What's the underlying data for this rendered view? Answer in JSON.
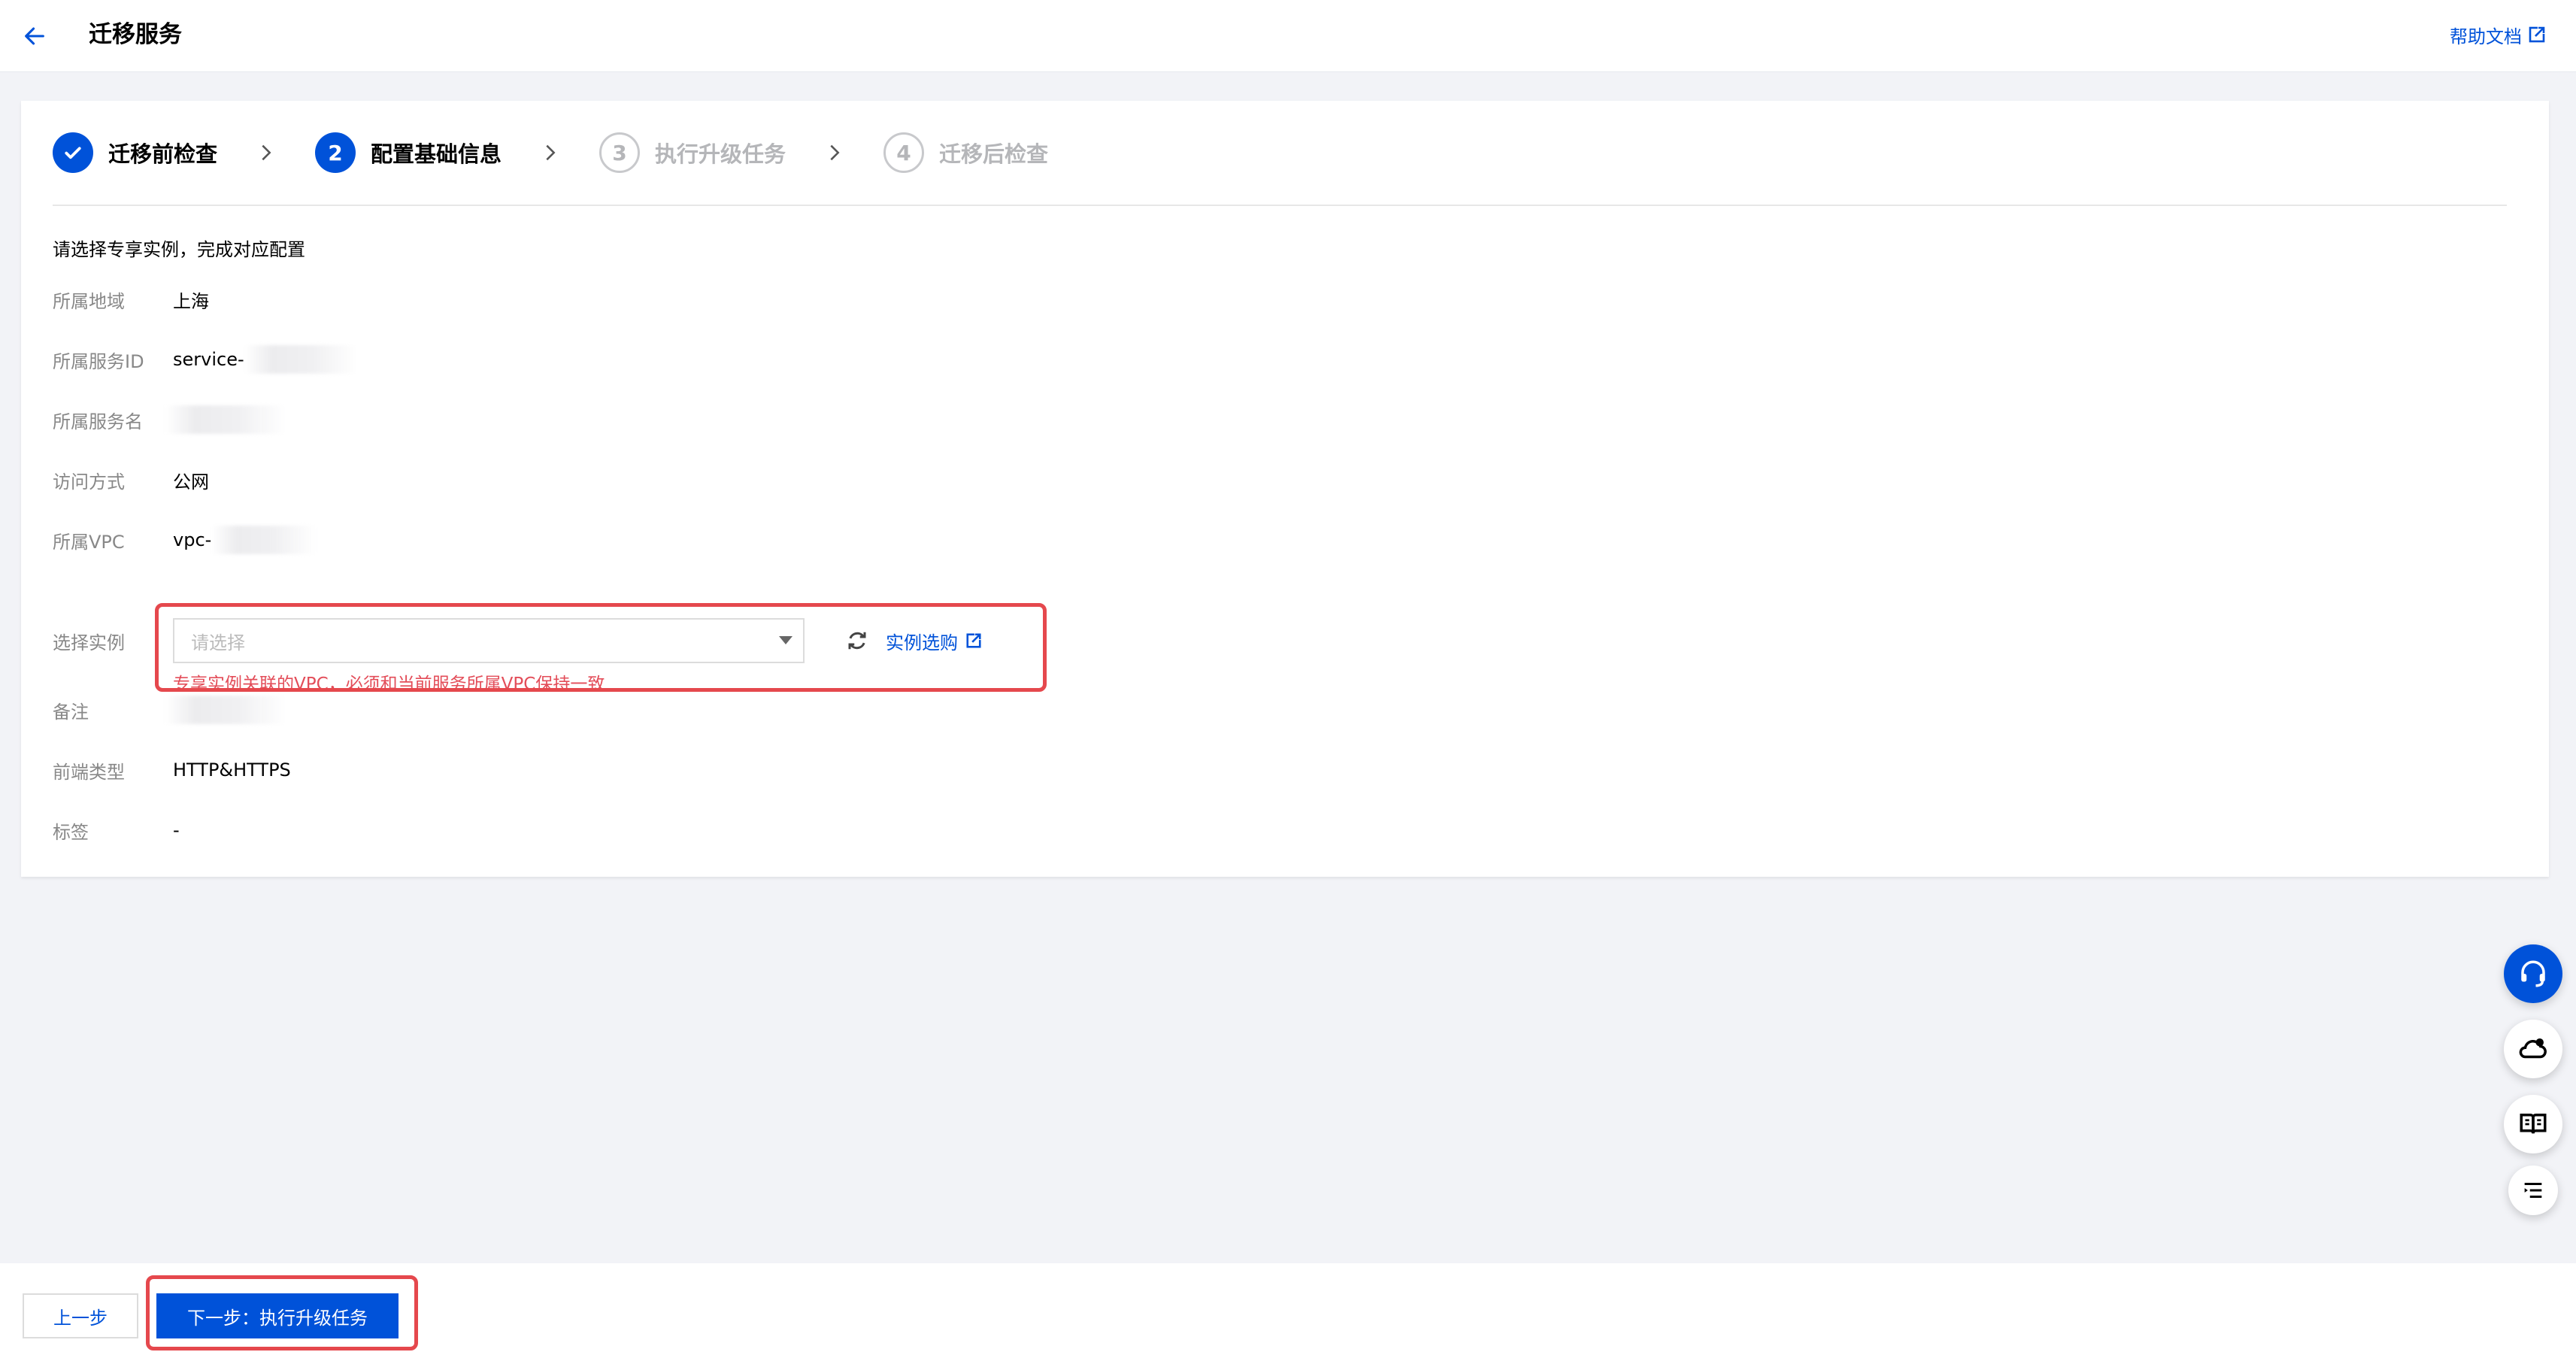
{
  "header": {
    "title": "迁移服务",
    "help_label": "帮助文档"
  },
  "steps": [
    {
      "label": "迁移前检查",
      "status": "done",
      "number": ""
    },
    {
      "label": "配置基础信息",
      "status": "active",
      "number": "2"
    },
    {
      "label": "执行升级任务",
      "status": "todo",
      "number": "3"
    },
    {
      "label": "迁移后检查",
      "status": "todo",
      "number": "4"
    }
  ],
  "form": {
    "intro": "请选择专享实例，完成对应配置",
    "region": {
      "label": "所属地域",
      "value": "上海"
    },
    "service_id": {
      "label": "所属服务ID",
      "value": "service-"
    },
    "service_name": {
      "label": "所属服务名",
      "value": ""
    },
    "access": {
      "label": "访问方式",
      "value": "公网"
    },
    "vpc": {
      "label": "所属VPC",
      "value": "vpc-"
    },
    "vpc_warning": "专享实例关联的VPC，必须和当前服务所属VPC保持一致",
    "instance": {
      "label": "选择实例",
      "placeholder": "请选择",
      "buy_label": "实例选购"
    },
    "remark": {
      "label": "备注",
      "value": ""
    },
    "frontend": {
      "label": "前端类型",
      "value": "HTTP&HTTPS"
    },
    "tags": {
      "label": "标签",
      "value": "-"
    }
  },
  "footer": {
    "prev_label": "上一步",
    "next_label": "下一步：执行升级任务"
  },
  "colors": {
    "primary": "#0052d9",
    "warning": "#e34d59",
    "highlight": "#e5484d"
  },
  "float_tools": [
    "headset-icon",
    "cloud-user-icon",
    "book-icon",
    "list-icon"
  ]
}
